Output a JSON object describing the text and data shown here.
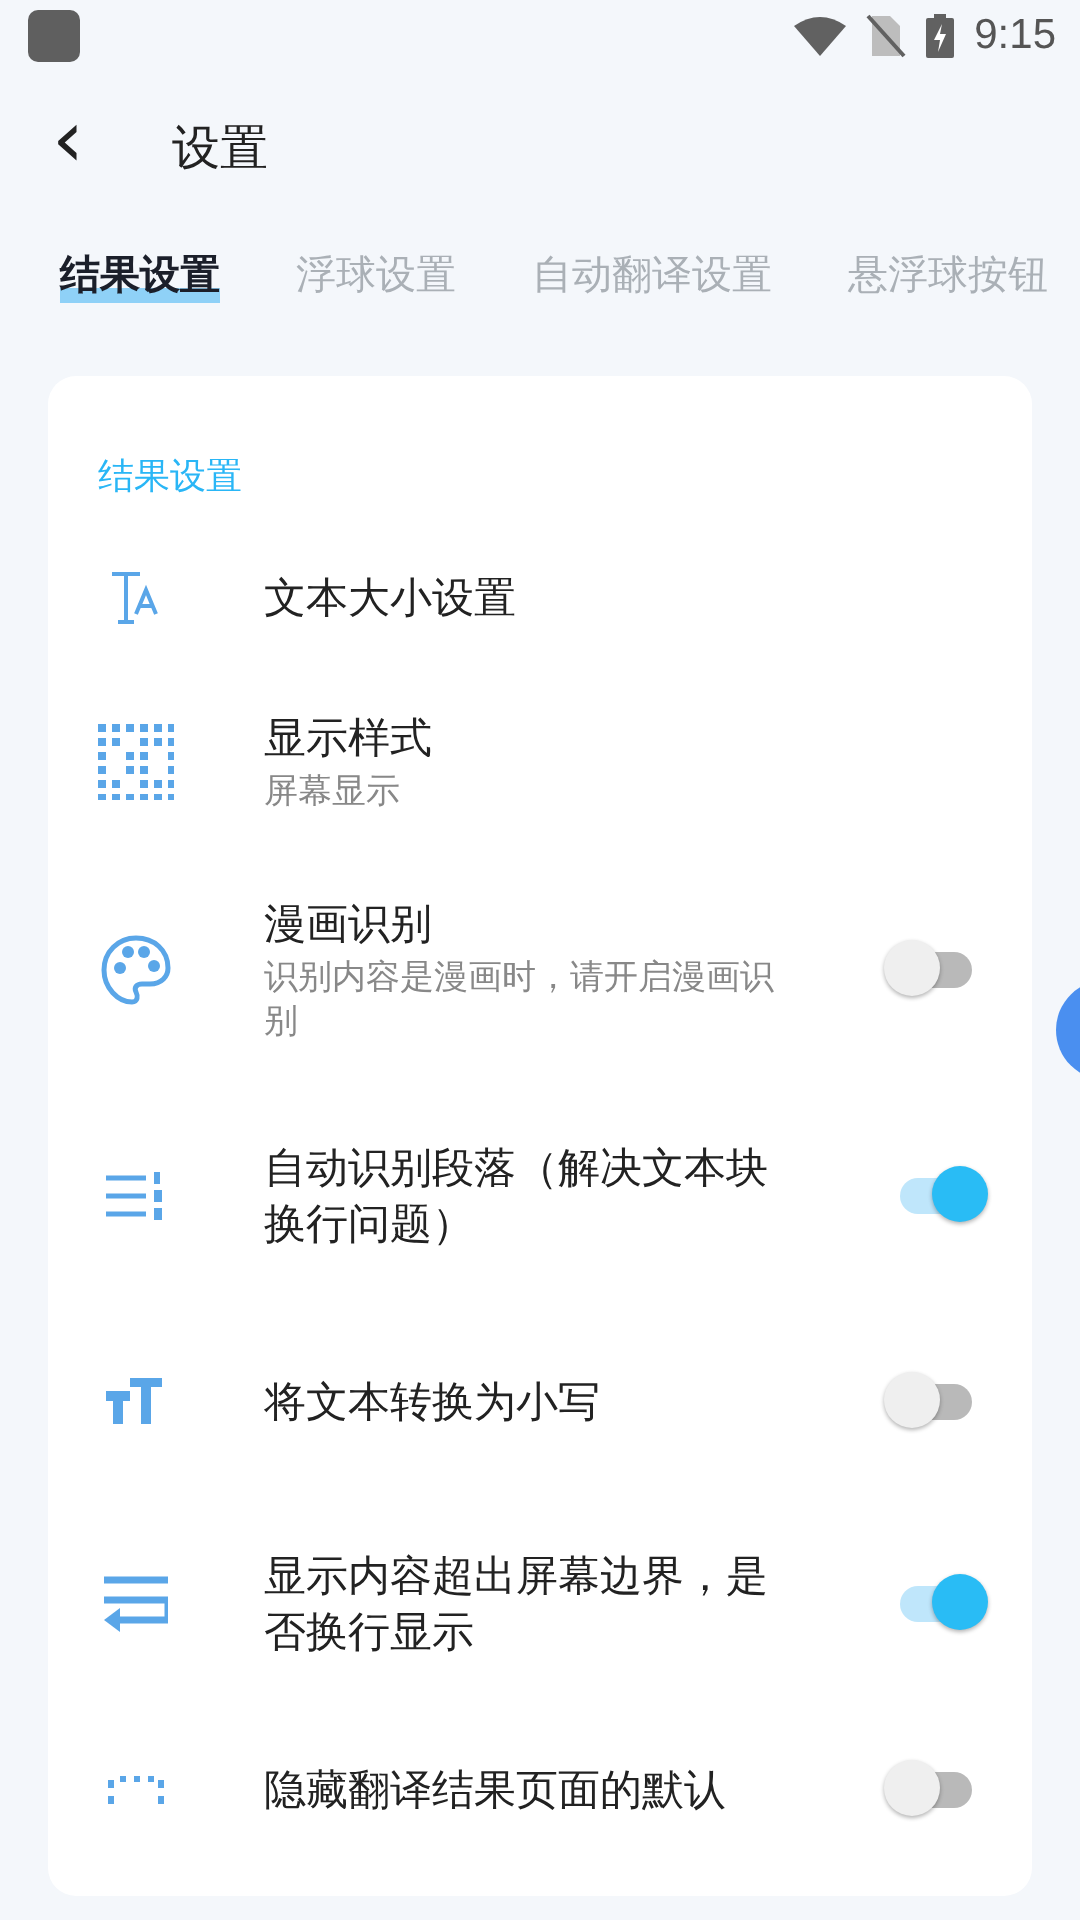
{
  "status_bar": {
    "time": "9:15"
  },
  "header": {
    "back": "‹",
    "title": "设置"
  },
  "tabs": [
    {
      "label": "结果设置",
      "selected": true
    },
    {
      "label": "浮球设置",
      "selected": false
    },
    {
      "label": "自动翻译设置",
      "selected": false
    },
    {
      "label": "悬浮球按钮",
      "selected": false
    }
  ],
  "section": {
    "title": "结果设置",
    "items": [
      {
        "kind": "link",
        "title": "文本大小设置"
      },
      {
        "kind": "link",
        "title": "显示样式",
        "subtitle": "屏幕显示"
      },
      {
        "kind": "toggle",
        "title": "漫画识别",
        "subtitle": "识别内容是漫画时，请开启漫画识别",
        "on": false
      },
      {
        "kind": "toggle",
        "title": "自动识别段落（解决文本块换行问题）",
        "on": true
      },
      {
        "kind": "toggle",
        "title": "将文本转换为小写",
        "on": false
      },
      {
        "kind": "toggle",
        "title": "显示内容超出屏幕边界，是否换行显示",
        "on": true
      },
      {
        "kind": "toggle",
        "title": "隐藏翻译结果页面的默认",
        "on": false
      }
    ]
  }
}
